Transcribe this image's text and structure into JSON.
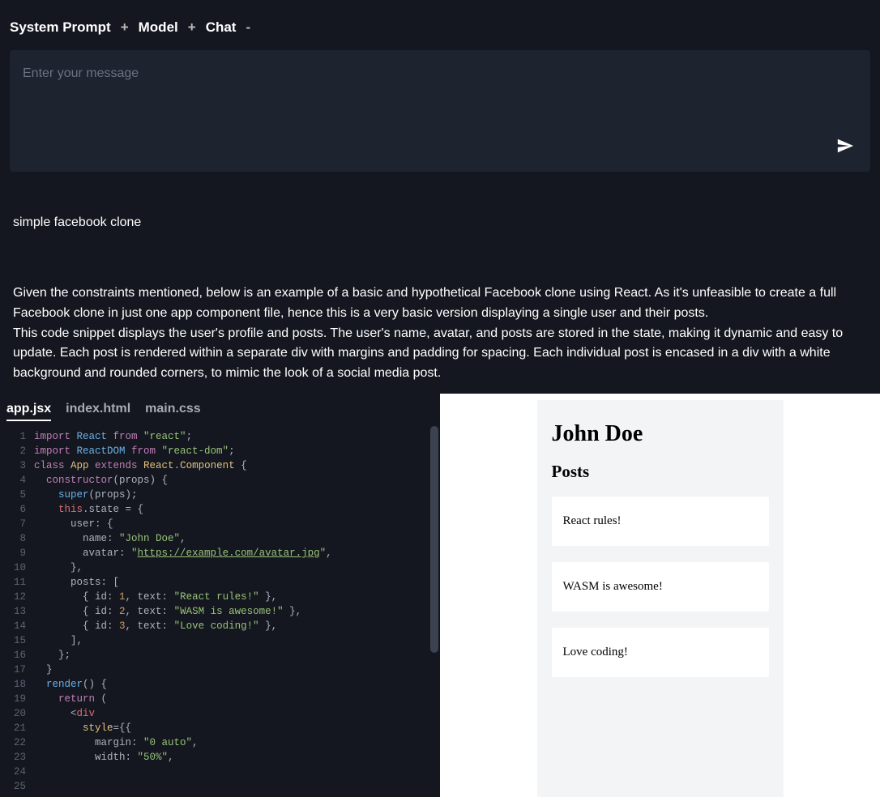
{
  "header": {
    "items": [
      "System Prompt",
      "Model",
      "Chat"
    ],
    "separator_plus": "+",
    "separator_minus": "-"
  },
  "message_box": {
    "placeholder": "Enter your message"
  },
  "user_prompt": "simple facebook clone",
  "assistant_response": {
    "p1": "Given the constraints mentioned, below is an example of a basic and hypothetical Facebook clone using React. As it's unfeasible to create a full Facebook clone in just one app component file, hence this is a very basic version displaying a single user and their posts.",
    "p2": "This code snippet displays the user's profile and posts. The user's name, avatar, and posts are stored in the state, making it dynamic and easy to update. Each post is rendered within a separate div with margins and padding for spacing. Each individual post is encased in a div with a white background and rounded corners, to mimic the look of a social media post."
  },
  "tabs": [
    {
      "label": "app.jsx",
      "active": true
    },
    {
      "label": "index.html",
      "active": false
    },
    {
      "label": "main.css",
      "active": false
    }
  ],
  "code": {
    "lines": [
      {
        "n": 1,
        "tokens": [
          [
            "kw",
            "import "
          ],
          [
            "ident",
            "React "
          ],
          [
            "kw",
            "from "
          ],
          [
            "str",
            "\"react\""
          ],
          [
            "plain",
            ";"
          ]
        ]
      },
      {
        "n": 2,
        "tokens": [
          [
            "kw",
            "import "
          ],
          [
            "ident",
            "ReactDOM "
          ],
          [
            "kw",
            "from "
          ],
          [
            "str",
            "\"react-dom\""
          ],
          [
            "plain",
            ";"
          ]
        ]
      },
      {
        "n": 3,
        "tokens": [
          [
            "plain",
            ""
          ]
        ]
      },
      {
        "n": 4,
        "tokens": [
          [
            "kw",
            "class "
          ],
          [
            "type",
            "App "
          ],
          [
            "kw",
            "extends "
          ],
          [
            "type",
            "React"
          ],
          [
            "plain",
            "."
          ],
          [
            "type",
            "Component"
          ],
          [
            "plain",
            " {"
          ]
        ]
      },
      {
        "n": 5,
        "tokens": [
          [
            "plain",
            "  "
          ],
          [
            "kw",
            "constructor"
          ],
          [
            "plain",
            "(props) {"
          ]
        ]
      },
      {
        "n": 6,
        "tokens": [
          [
            "plain",
            "    "
          ],
          [
            "ident",
            "super"
          ],
          [
            "plain",
            "(props);"
          ]
        ]
      },
      {
        "n": 7,
        "tokens": [
          [
            "plain",
            "    "
          ],
          [
            "this",
            "this"
          ],
          [
            "plain",
            ".state = {"
          ]
        ]
      },
      {
        "n": 8,
        "tokens": [
          [
            "plain",
            "      user: {"
          ]
        ]
      },
      {
        "n": 9,
        "tokens": [
          [
            "plain",
            "        name: "
          ],
          [
            "str",
            "\"John Doe\""
          ],
          [
            "plain",
            ","
          ]
        ]
      },
      {
        "n": 10,
        "tokens": [
          [
            "plain",
            "        avatar: "
          ],
          [
            "str",
            "\""
          ],
          [
            "strunder",
            "https://example.com/avatar.jpg"
          ],
          [
            "str",
            "\""
          ],
          [
            "plain",
            ","
          ]
        ]
      },
      {
        "n": 11,
        "tokens": [
          [
            "plain",
            "      },"
          ]
        ]
      },
      {
        "n": 12,
        "tokens": [
          [
            "plain",
            "      posts: ["
          ]
        ]
      },
      {
        "n": 13,
        "tokens": [
          [
            "plain",
            "        { id: "
          ],
          [
            "num",
            "1"
          ],
          [
            "plain",
            ", text: "
          ],
          [
            "str",
            "\"React rules!\""
          ],
          [
            "plain",
            " },"
          ]
        ]
      },
      {
        "n": 14,
        "tokens": [
          [
            "plain",
            "        { id: "
          ],
          [
            "num",
            "2"
          ],
          [
            "plain",
            ", text: "
          ],
          [
            "str",
            "\"WASM is awesome!\""
          ],
          [
            "plain",
            " },"
          ]
        ]
      },
      {
        "n": 15,
        "tokens": [
          [
            "plain",
            "        { id: "
          ],
          [
            "num",
            "3"
          ],
          [
            "plain",
            ", text: "
          ],
          [
            "str",
            "\"Love coding!\""
          ],
          [
            "plain",
            " },"
          ]
        ]
      },
      {
        "n": 16,
        "tokens": [
          [
            "plain",
            "      ],"
          ]
        ]
      },
      {
        "n": 17,
        "tokens": [
          [
            "plain",
            "    };"
          ]
        ]
      },
      {
        "n": 18,
        "tokens": [
          [
            "plain",
            "  }"
          ]
        ]
      },
      {
        "n": 19,
        "tokens": [
          [
            "plain",
            ""
          ]
        ]
      },
      {
        "n": 20,
        "tokens": [
          [
            "plain",
            "  "
          ],
          [
            "ident",
            "render"
          ],
          [
            "plain",
            "() {"
          ]
        ]
      },
      {
        "n": 21,
        "tokens": [
          [
            "plain",
            "    "
          ],
          [
            "kw",
            "return"
          ],
          [
            "plain",
            " ("
          ]
        ]
      },
      {
        "n": 22,
        "tokens": [
          [
            "plain",
            "      <"
          ],
          [
            "this",
            "div"
          ]
        ]
      },
      {
        "n": 23,
        "tokens": [
          [
            "plain",
            "        "
          ],
          [
            "type",
            "style"
          ],
          [
            "plain",
            "={{"
          ]
        ]
      },
      {
        "n": 24,
        "tokens": [
          [
            "plain",
            "          margin: "
          ],
          [
            "str",
            "\"0 auto\""
          ],
          [
            "plain",
            ","
          ]
        ]
      },
      {
        "n": 25,
        "tokens": [
          [
            "plain",
            "          width: "
          ],
          [
            "str",
            "\"50%\""
          ],
          [
            "plain",
            ","
          ]
        ]
      }
    ]
  },
  "preview": {
    "user_name": "John Doe",
    "posts_label": "Posts",
    "posts": [
      {
        "text": "React rules!"
      },
      {
        "text": "WASM is awesome!"
      },
      {
        "text": "Love coding!"
      }
    ]
  }
}
